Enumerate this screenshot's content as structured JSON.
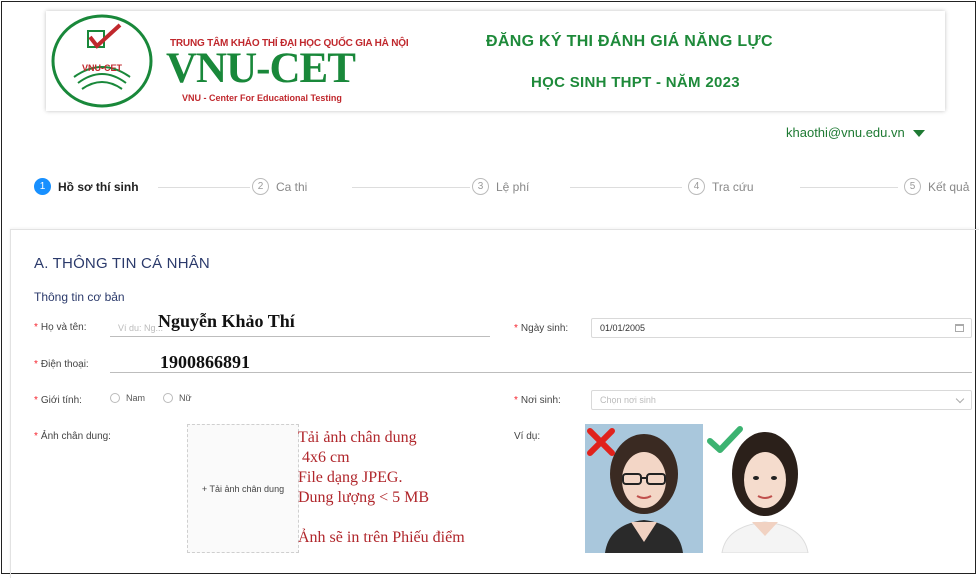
{
  "header": {
    "brand_top": "TRUNG TÂM KHẢO THÍ ĐẠI HỌC QUỐC GIA HÀ NỘI",
    "brand_main": "VNU-CET",
    "brand_sub": "VNU - Center For Educational Testing",
    "logo_text": "VNU-CET",
    "title_line1": "ĐĂNG KÝ THI ĐÁNH GIÁ NĂNG LỰC",
    "title_line2": "HỌC SINH THPT - NĂM 2023",
    "account_email": "khaothi@vnu.edu.vn"
  },
  "steps": [
    {
      "num": "1",
      "label": "Hồ sơ thí sinh",
      "active": true
    },
    {
      "num": "2",
      "label": "Ca thi",
      "active": false
    },
    {
      "num": "3",
      "label": "Lệ phí",
      "active": false
    },
    {
      "num": "4",
      "label": "Tra cứu",
      "active": false
    },
    {
      "num": "5",
      "label": "Kết quả",
      "active": false
    }
  ],
  "form": {
    "section_title": "A. THÔNG TIN CÁ NHÂN",
    "subsection_title": "Thông tin cơ bản",
    "required_mark": "*",
    "fullname": {
      "label": "Họ và tên:",
      "placeholder": "Ví du: Ng...",
      "value": "Nguyễn Khảo Thí"
    },
    "dob": {
      "label": "Ngày sinh:",
      "value": "01/01/2005"
    },
    "phone": {
      "label": "Điện thoại:",
      "value": "1900866891"
    },
    "gender": {
      "label": "Giới tính:",
      "options": [
        "Nam",
        "Nữ"
      ]
    },
    "birthplace": {
      "label": "Nơi sinh:",
      "placeholder": "Chọn nơi sinh"
    },
    "photo": {
      "label": "Ảnh chân dung:",
      "upload_label": "+ Tải ảnh chân dung"
    },
    "example_label": "Ví dụ:",
    "notes": [
      "Tải ảnh chân dung",
      " 4x6 cm",
      "File dạng JPEG.",
      "Dung lượng < 5 MB",
      "",
      "Ảnh sẽ in trên Phiếu điểm"
    ]
  },
  "colors": {
    "brand_green": "#19883a",
    "brand_red": "#c0282d",
    "step_active": "#1890ff",
    "required": "#f5222d"
  }
}
